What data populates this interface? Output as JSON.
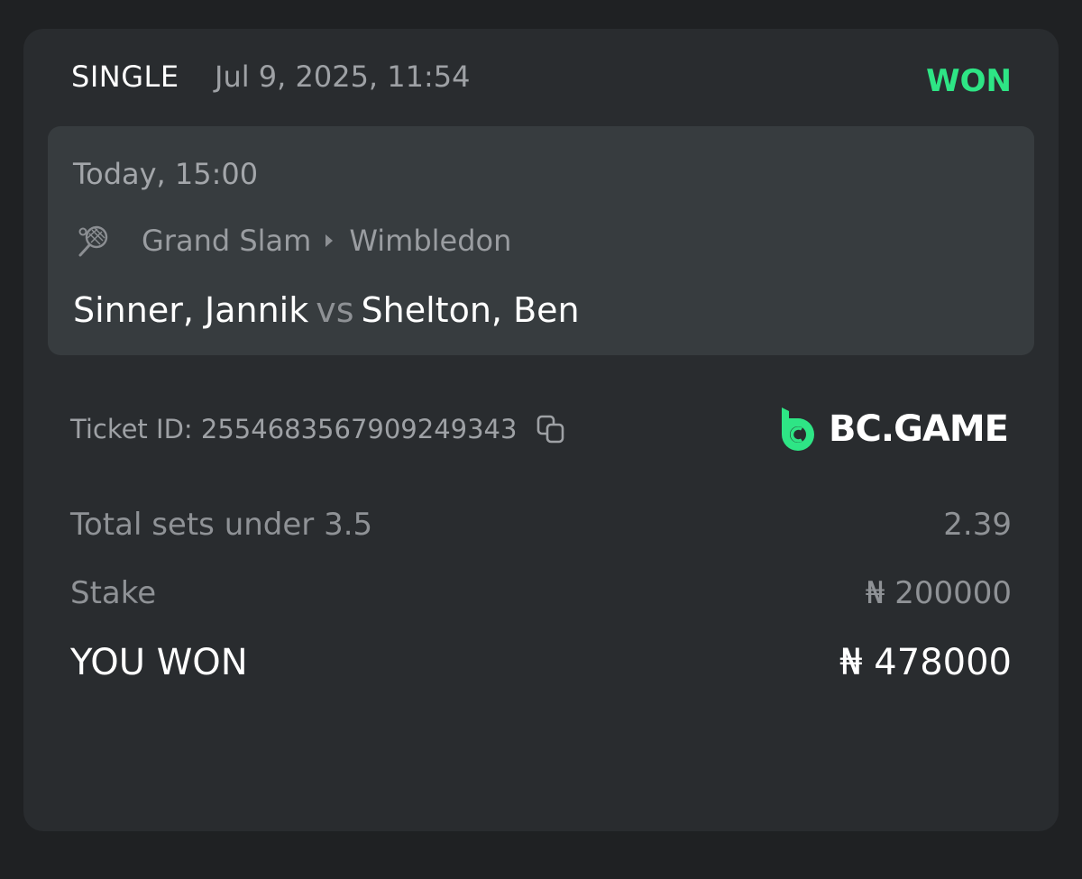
{
  "header": {
    "bet_type": "SINGLE",
    "date": "Jul 9, 2025, 11:54",
    "status": "WON",
    "status_color": "#2ee585"
  },
  "event": {
    "time": "Today, 15:00",
    "sport_icon": "tennis-racket-icon",
    "category": "Grand Slam",
    "tournament": "Wimbledon",
    "home": "Sinner, Jannik",
    "vs": "vs",
    "away": "Shelton, Ben"
  },
  "ticket": {
    "label": "Ticket ID: 2554683567909249343",
    "copy_icon": "copy-icon"
  },
  "brand": {
    "name": "BC.GAME",
    "color": "#2ee585"
  },
  "details": {
    "market": "Total sets under 3.5",
    "odds": "2.39",
    "stake_label": "Stake",
    "stake_value": "₦ 200000",
    "won_label": "YOU WON",
    "won_value": "₦ 478000"
  }
}
